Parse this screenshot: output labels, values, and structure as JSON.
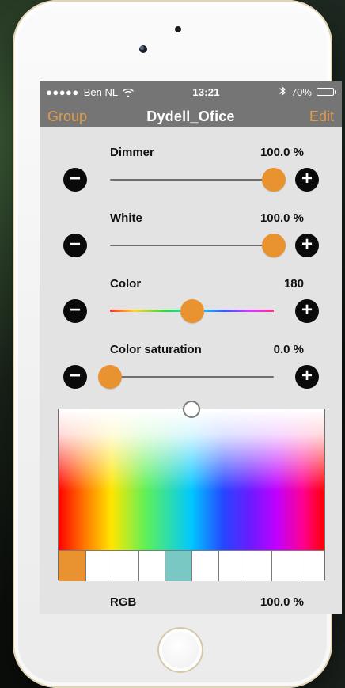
{
  "status_bar": {
    "carrier_dots": "●●●●●",
    "carrier": "Ben NL",
    "wifi_icon": "wifi-icon",
    "time": "13:21",
    "bluetooth_icon": "bluetooth-icon",
    "battery_percent_label": "70%",
    "battery_level": 0.7
  },
  "nav_bar": {
    "left_label": "Group",
    "title": "Dydell_Ofice",
    "right_label": "Edit",
    "accent": "#e09b4b"
  },
  "controls": [
    {
      "label": "Dimmer",
      "value_label": "100.0 %",
      "position": 1.0
    },
    {
      "label": "White",
      "value_label": "100.0 %",
      "position": 1.0
    },
    {
      "label": "Color",
      "value_label": "180",
      "position": 0.5
    },
    {
      "label": "Color saturation",
      "value_label": "0.0 %",
      "position": 0.0
    }
  ],
  "picker": {
    "handle_position": 0.5,
    "swatches": [
      "#e8932f",
      "#ffffff",
      "#ffffff",
      "#ffffff",
      "#79c8c3",
      "#ffffff",
      "#ffffff",
      "#ffffff",
      "#ffffff",
      "#ffffff"
    ]
  },
  "rgb": {
    "label": "RGB",
    "value_label": "100.0 %"
  },
  "icons": {
    "minus": "minus-icon",
    "plus": "plus-icon"
  },
  "colors": {
    "thumb": "#e8932f",
    "screen_bg": "#e3e3e3",
    "nav_bg": "#757575"
  }
}
